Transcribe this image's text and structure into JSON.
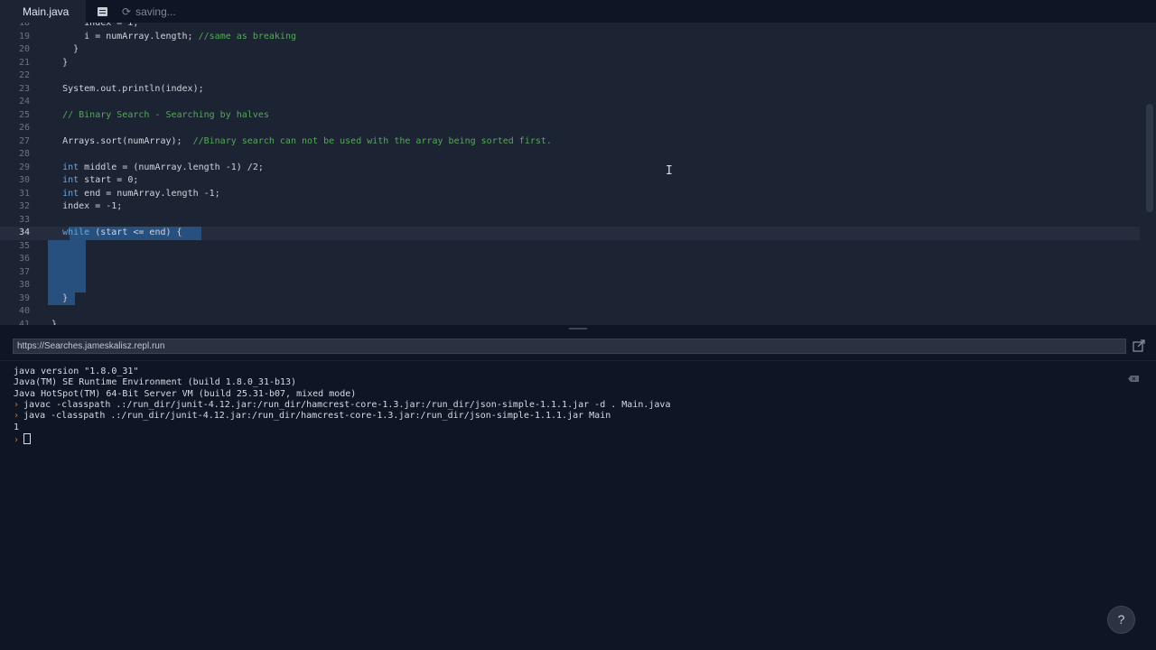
{
  "tabs": [
    {
      "label": "Main.java",
      "active": true
    }
  ],
  "status": {
    "text": "saving...",
    "icon": "refresh-icon"
  },
  "editor": {
    "active_line": "34",
    "lines": [
      {
        "n": "18",
        "segs": [
          {
            "t": "        index = i;",
            "c": "plain"
          }
        ]
      },
      {
        "n": "19",
        "segs": [
          {
            "t": "        i = numArray.length; ",
            "c": "plain"
          },
          {
            "t": "//same as breaking",
            "c": "comment"
          }
        ]
      },
      {
        "n": "20",
        "segs": [
          {
            "t": "      }",
            "c": "plain"
          }
        ]
      },
      {
        "n": "21",
        "segs": [
          {
            "t": "    }",
            "c": "plain"
          }
        ]
      },
      {
        "n": "22",
        "segs": []
      },
      {
        "n": "23",
        "segs": [
          {
            "t": "    System.out.println(index);",
            "c": "plain"
          }
        ]
      },
      {
        "n": "24",
        "segs": []
      },
      {
        "n": "25",
        "segs": [
          {
            "t": "    // Binary Search - Searching by halves",
            "c": "comment"
          }
        ]
      },
      {
        "n": "26",
        "segs": []
      },
      {
        "n": "27",
        "segs": [
          {
            "t": "    Arrays.sort(numArray);  ",
            "c": "plain"
          },
          {
            "t": "//Binary search can not be used with the array being sorted first.",
            "c": "comment"
          }
        ]
      },
      {
        "n": "28",
        "segs": []
      },
      {
        "n": "29",
        "segs": [
          {
            "t": "    ",
            "c": "plain"
          },
          {
            "t": "int",
            "c": "keyword"
          },
          {
            "t": " middle = (numArray.length -1) /2;",
            "c": "plain"
          }
        ]
      },
      {
        "n": "30",
        "segs": [
          {
            "t": "    ",
            "c": "plain"
          },
          {
            "t": "int",
            "c": "keyword"
          },
          {
            "t": " start = 0;",
            "c": "plain"
          }
        ]
      },
      {
        "n": "31",
        "segs": [
          {
            "t": "    ",
            "c": "plain"
          },
          {
            "t": "int",
            "c": "keyword"
          },
          {
            "t": " end = numArray.length -1;",
            "c": "plain"
          }
        ]
      },
      {
        "n": "32",
        "segs": [
          {
            "t": "    index = -1;",
            "c": "plain"
          }
        ]
      },
      {
        "n": "33",
        "segs": []
      },
      {
        "n": "34",
        "segs": [
          {
            "t": "    ",
            "c": "plain"
          },
          {
            "t": "while",
            "c": "keyword"
          },
          {
            "t": " (start <= end) {",
            "c": "plain"
          }
        ]
      },
      {
        "n": "35",
        "segs": []
      },
      {
        "n": "36",
        "segs": []
      },
      {
        "n": "37",
        "segs": []
      },
      {
        "n": "38",
        "segs": []
      },
      {
        "n": "39",
        "segs": [
          {
            "t": "    }",
            "c": "plain"
          }
        ]
      },
      {
        "n": "40",
        "segs": []
      },
      {
        "n": "41",
        "segs": [
          {
            "t": "  }",
            "c": "plain"
          }
        ]
      }
    ]
  },
  "url": "https://Searches.jameskalisz.repl.run",
  "console": {
    "lines": [
      {
        "prompt": false,
        "text": "java version \"1.8.0_31\""
      },
      {
        "prompt": false,
        "text": "Java(TM) SE Runtime Environment (build 1.8.0_31-b13)"
      },
      {
        "prompt": false,
        "text": "Java HotSpot(TM) 64-Bit Server VM (build 25.31-b07, mixed mode)"
      },
      {
        "prompt": true,
        "text": "javac -classpath .:/run_dir/junit-4.12.jar:/run_dir/hamcrest-core-1.3.jar:/run_dir/json-simple-1.1.1.jar -d . Main.java"
      },
      {
        "prompt": true,
        "text": "java -classpath .:/run_dir/junit-4.12.jar:/run_dir/hamcrest-core-1.3.jar:/run_dir/json-simple-1.1.1.jar Main"
      },
      {
        "prompt": false,
        "text": "1"
      },
      {
        "prompt": true,
        "text": "",
        "caret": true
      }
    ]
  },
  "help": {
    "label": "?"
  },
  "colors": {
    "accent_prompt": "#f26b21",
    "keyword": "#6fa4d9",
    "comment": "#56a85a",
    "selection": "#27507f"
  }
}
